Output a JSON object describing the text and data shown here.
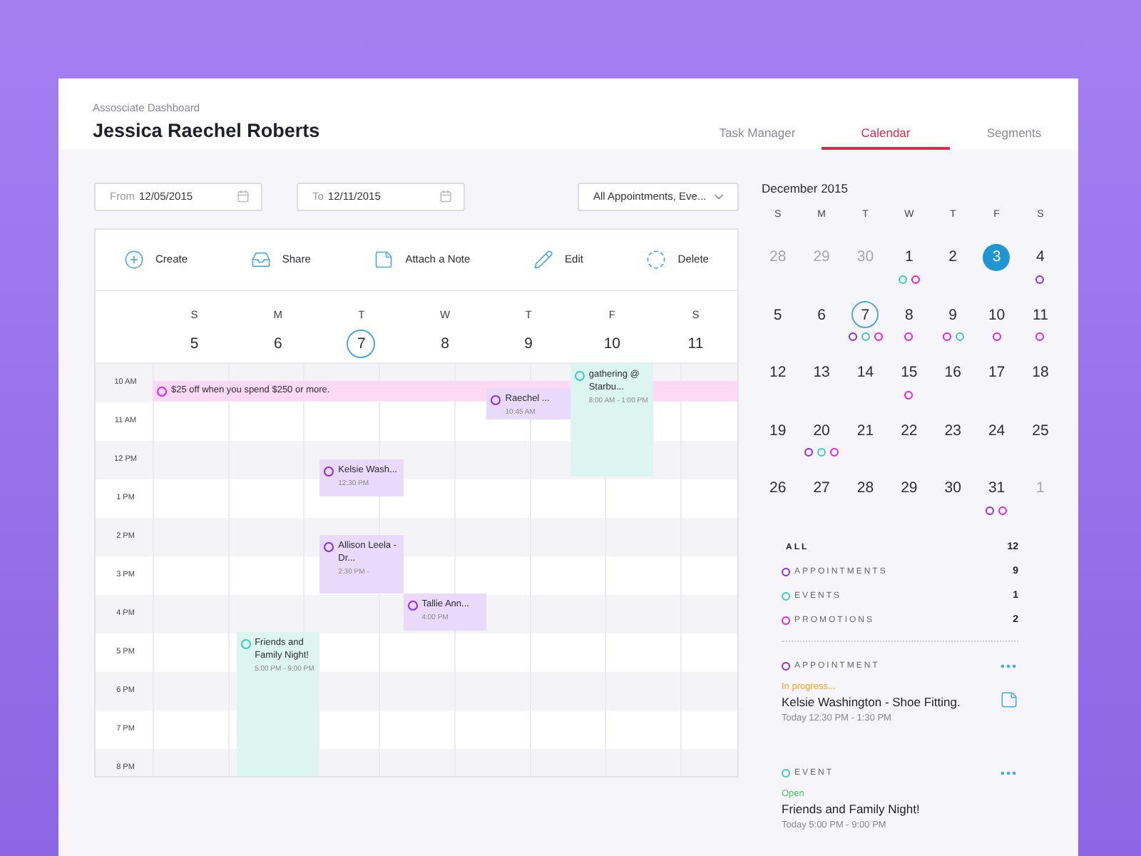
{
  "header": {
    "breadcrumb": "Assosciate Dashboard",
    "title": "Jessica Raechel Roberts",
    "tabs": [
      {
        "label": "Task Manager",
        "selected": false
      },
      {
        "label": "Calendar",
        "selected": true
      },
      {
        "label": "Segments",
        "selected": false
      }
    ]
  },
  "filters": {
    "from": {
      "label": "From",
      "value": "12/05/2015"
    },
    "to": {
      "label": "To",
      "value": "12/11/2015"
    },
    "type": {
      "value": "All Appointments, Eve..."
    }
  },
  "toolbar": [
    {
      "kind": "create",
      "label": "Create"
    },
    {
      "kind": "share",
      "label": "Share"
    },
    {
      "kind": "note",
      "label": "Attach a Note"
    },
    {
      "kind": "edit",
      "label": "Edit"
    },
    {
      "kind": "delete",
      "label": "Delete"
    }
  ],
  "week": [
    {
      "letter": "S",
      "date": "5",
      "today": false
    },
    {
      "letter": "M",
      "date": "6",
      "today": false
    },
    {
      "letter": "T",
      "date": "7",
      "today": true
    },
    {
      "letter": "W",
      "date": "8",
      "today": false
    },
    {
      "letter": "T",
      "date": "9",
      "today": false
    },
    {
      "letter": "F",
      "date": "10",
      "today": false
    },
    {
      "letter": "S",
      "date": "11",
      "today": false
    }
  ],
  "hours": [
    "10 AM",
    "11 AM",
    "12 PM",
    "1 PM",
    "2 PM",
    "3 PM",
    "4 PM",
    "5 PM",
    "6 PM",
    "7 PM",
    "8 PM"
  ],
  "events": [
    {
      "kind": "promotion",
      "title": "$25 off when you spend $250 or more."
    },
    {
      "kind": "appointment",
      "title": "Raechel ...",
      "time": "10:45 AM"
    },
    {
      "kind": "event",
      "title": "gathering @ Starbu...",
      "time": "8:00 AM - 1:00 PM"
    },
    {
      "kind": "appointment",
      "title": "Kelsie Wash...",
      "time": "12:30 PM"
    },
    {
      "kind": "appointment",
      "title": "Allison Leela - Dr...",
      "time": "2:30 PM -"
    },
    {
      "kind": "appointment",
      "title": "Tallie Ann...",
      "time": "4:00 PM"
    },
    {
      "kind": "event",
      "title": "Friends and Family Night!",
      "time": "5:00 PM - 9:00 PM"
    }
  ],
  "month": {
    "title": "December 2015",
    "weekdays": [
      "S",
      "M",
      "T",
      "W",
      "T",
      "F",
      "S"
    ],
    "weeks": [
      [
        {
          "label": "28",
          "muted": true,
          "selected": false,
          "today": false
        },
        {
          "label": "29",
          "muted": true,
          "selected": false,
          "today": false
        },
        {
          "label": "30",
          "muted": true,
          "selected": false,
          "today": false
        },
        {
          "label": "1",
          "muted": false,
          "selected": false,
          "today": false,
          "dots": [
            {
              "color": "#3ccbb8"
            },
            {
              "color": "#ee1fcf"
            }
          ]
        },
        {
          "label": "2",
          "muted": false,
          "selected": false,
          "today": false
        },
        {
          "label": "3",
          "muted": false,
          "selected": true,
          "today": false
        },
        {
          "label": "4",
          "muted": false,
          "selected": false,
          "today": false,
          "dots": [
            {
              "color": "#8b2be8"
            }
          ]
        }
      ],
      [
        {
          "label": "5",
          "muted": false,
          "selected": false,
          "today": false
        },
        {
          "label": "6",
          "muted": false,
          "selected": false,
          "today": false
        },
        {
          "label": "7",
          "muted": false,
          "selected": false,
          "today": true,
          "dots": [
            {
              "color": "#8b2be8"
            },
            {
              "color": "#3ccbb8"
            },
            {
              "color": "#ee1fcf"
            }
          ]
        },
        {
          "label": "8",
          "muted": false,
          "selected": false,
          "today": false,
          "dots": [
            {
              "color": "#ee1fcf"
            }
          ]
        },
        {
          "label": "9",
          "muted": false,
          "selected": false,
          "today": false,
          "dots": [
            {
              "color": "#ee1fcf"
            },
            {
              "color": "#3ccbb8"
            }
          ]
        },
        {
          "label": "10",
          "muted": false,
          "selected": false,
          "today": false,
          "dots": [
            {
              "color": "#ee1fcf"
            }
          ]
        },
        {
          "label": "11",
          "muted": false,
          "selected": false,
          "today": false,
          "dots": [
            {
              "color": "#ee1fcf"
            }
          ]
        }
      ],
      [
        {
          "label": "12",
          "muted": false,
          "selected": false,
          "today": false
        },
        {
          "label": "13",
          "muted": false,
          "selected": false,
          "today": false
        },
        {
          "label": "14",
          "muted": false,
          "selected": false,
          "today": false
        },
        {
          "label": "15",
          "muted": false,
          "selected": false,
          "today": false,
          "dots": [
            {
              "color": "#ee1fcf"
            }
          ]
        },
        {
          "label": "16",
          "muted": false,
          "selected": false,
          "today": false
        },
        {
          "label": "17",
          "muted": false,
          "selected": false,
          "today": false
        },
        {
          "label": "18",
          "muted": false,
          "selected": false,
          "today": false
        }
      ],
      [
        {
          "label": "19",
          "muted": false,
          "selected": false,
          "today": false
        },
        {
          "label": "20",
          "muted": false,
          "selected": false,
          "today": false,
          "dots": [
            {
              "color": "#8b2be8"
            },
            {
              "color": "#3ccbb8"
            },
            {
              "color": "#ee1fcf"
            }
          ]
        },
        {
          "label": "21",
          "muted": false,
          "selected": false,
          "today": false
        },
        {
          "label": "22",
          "muted": false,
          "selected": false,
          "today": false
        },
        {
          "label": "23",
          "muted": false,
          "selected": false,
          "today": false
        },
        {
          "label": "24",
          "muted": false,
          "selected": false,
          "today": false
        },
        {
          "label": "25",
          "muted": false,
          "selected": false,
          "today": false
        }
      ],
      [
        {
          "label": "26",
          "muted": false,
          "selected": false,
          "today": false
        },
        {
          "label": "27",
          "muted": false,
          "selected": false,
          "today": false
        },
        {
          "label": "28",
          "muted": false,
          "selected": false,
          "today": false
        },
        {
          "label": "29",
          "muted": false,
          "selected": false,
          "today": false
        },
        {
          "label": "30",
          "muted": false,
          "selected": false,
          "today": false
        },
        {
          "label": "31",
          "muted": false,
          "selected": false,
          "today": false,
          "dots": [
            {
              "color": "#8b2be8"
            },
            {
              "color": "#ee1fcf"
            }
          ]
        },
        {
          "label": "1",
          "muted": true,
          "selected": false,
          "today": false
        }
      ]
    ]
  },
  "summary": {
    "all": {
      "label": "ALL",
      "count": "12"
    },
    "items": [
      {
        "label": "APPOINTMENTS",
        "count": "9",
        "color": "#8b2be8"
      },
      {
        "label": "EVENTS",
        "count": "1",
        "color": "#3ccbb8"
      },
      {
        "label": "PROMOTIONS",
        "count": "2",
        "color": "#ee1fcf"
      }
    ]
  },
  "cards": [
    {
      "type_label": "APPOINTMENT",
      "color": "#8b2be8",
      "kind": "appointment",
      "status": "In progress...",
      "title": "Kelsie Washington - Shoe Fitting.",
      "time": "Today 12:30 PM - 1:30 PM",
      "has_note": true
    },
    {
      "type_label": "EVENT",
      "color": "#3ccbb8",
      "kind": "event",
      "status": "Open",
      "title": "Friends and Family Night!",
      "time": "Today 5:00 PM - 9:00 PM",
      "has_note": false
    }
  ]
}
